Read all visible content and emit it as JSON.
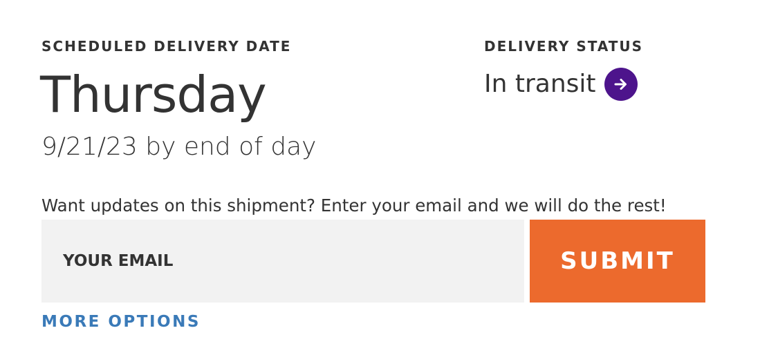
{
  "scheduled": {
    "label": "SCHEDULED DELIVERY DATE",
    "day": "Thursday",
    "date_line": "9/21/23 by end of day"
  },
  "status": {
    "label": "DELIVERY STATUS",
    "value": "In transit",
    "arrow_icon": "arrow-right-circle-icon",
    "arrow_color": "#4d148c"
  },
  "updates": {
    "prompt": "Want updates on this shipment? Enter your email and we will do the rest!",
    "email_placeholder": "YOUR EMAIL",
    "submit_label": "SUBMIT",
    "submit_color": "#ec6a2d",
    "more_options_label": "MORE OPTIONS",
    "link_color": "#3a7ab8"
  }
}
